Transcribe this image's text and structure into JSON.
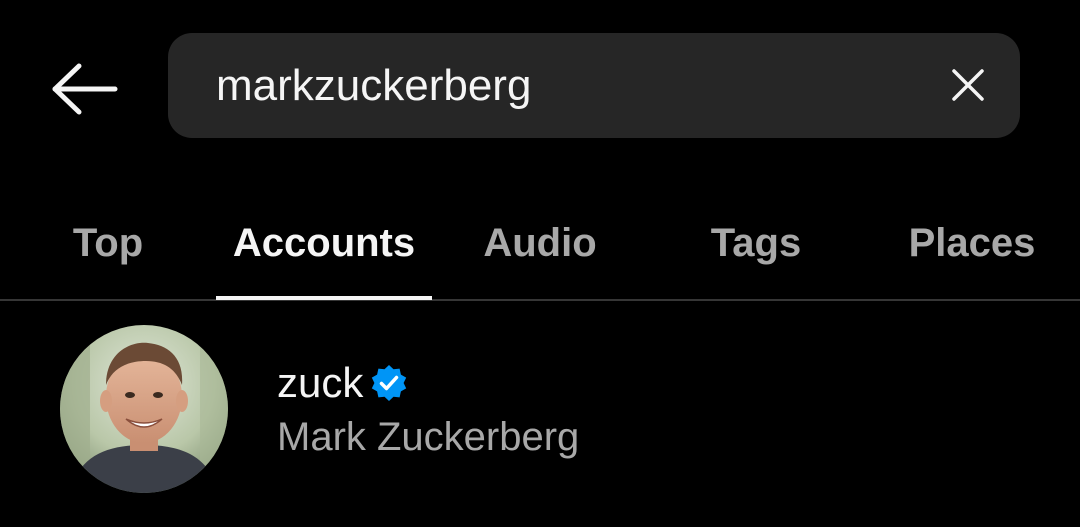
{
  "search": {
    "value": "markzuckerberg",
    "placeholder": "Search"
  },
  "tabs": [
    {
      "label": "Top",
      "active": false
    },
    {
      "label": "Accounts",
      "active": true
    },
    {
      "label": "Audio",
      "active": false
    },
    {
      "label": "Tags",
      "active": false
    },
    {
      "label": "Places",
      "active": false
    }
  ],
  "results": [
    {
      "username": "zuck",
      "full_name": "Mark Zuckerberg",
      "verified": true,
      "avatar_icon": "profile-photo"
    }
  ],
  "icons": {
    "back": "arrow-left-icon",
    "clear": "close-icon",
    "verified": "verified-badge-icon"
  },
  "colors": {
    "background": "#000000",
    "search_bg": "#262626",
    "text_primary": "#f5f5f5",
    "text_secondary": "#a8a8a8",
    "verified_blue": "#0095f6"
  }
}
